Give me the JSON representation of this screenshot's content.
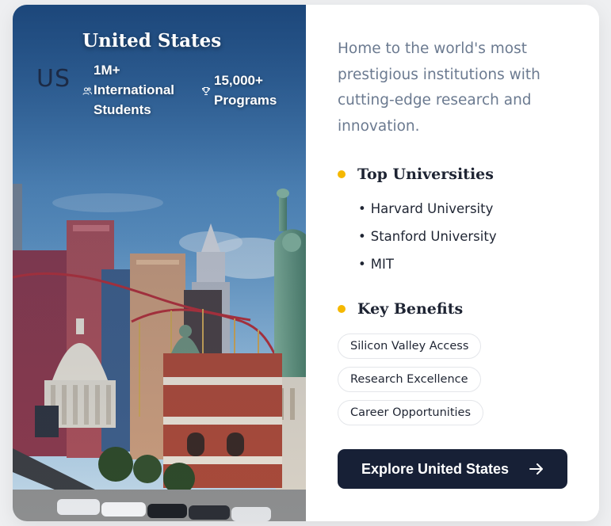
{
  "country": {
    "code": "US",
    "name": "United States",
    "stats": {
      "students_value": "1M+",
      "students_label_1": "International",
      "students_label_2": "Students",
      "students_icon": "users-icon",
      "programs_value": "15,000+",
      "programs_label": "Programs",
      "programs_icon": "trophy-icon"
    },
    "image": "las-vegas-skyline-photo"
  },
  "description": "Home to the world's most prestigious institutions with cutting-edge research and innovation.",
  "top_universities": {
    "heading": "Top Universities",
    "items": [
      "Harvard University",
      "Stanford University",
      "MIT"
    ]
  },
  "key_benefits": {
    "heading": "Key Benefits",
    "items": [
      "Silicon Valley Access",
      "Research Excellence",
      "Career Opportunities"
    ]
  },
  "cta": {
    "label": "Explore United States",
    "icon": "arrow-right-icon"
  },
  "colors": {
    "accent_dot": "#f5b800",
    "button_bg": "#172036",
    "description_text": "#6b7a90",
    "heading_text": "#1e2433"
  }
}
